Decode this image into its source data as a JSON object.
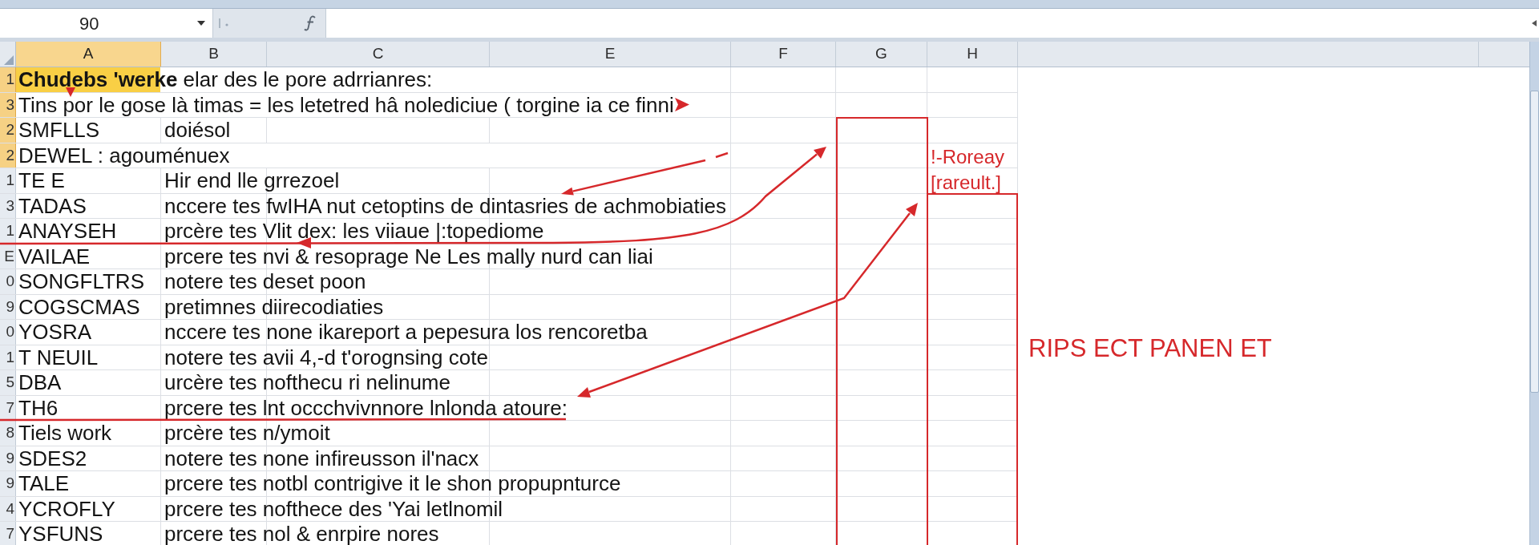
{
  "name_box": {
    "value": "90"
  },
  "columns": [
    {
      "label": "A",
      "selected": true
    },
    {
      "label": "B",
      "selected": false
    },
    {
      "label": "C",
      "selected": false
    },
    {
      "label": "E",
      "selected": false
    },
    {
      "label": "F",
      "selected": false
    },
    {
      "label": "G",
      "selected": false
    },
    {
      "label": "H",
      "selected": false
    }
  ],
  "rows": [
    {
      "header": "1",
      "selected": true,
      "highlighted": true,
      "A": "**Chudebs 'werke** elar des le pore adrrianres:"
    },
    {
      "header": "3",
      "selected": true,
      "highlighted": false,
      "A": "Tins por le gose là timas = les letetred hâ nolediciue ( torgine ia ce finni"
    },
    {
      "header": "2",
      "selected": true,
      "highlighted": false,
      "A": "SMFLLS",
      "B": "doiésol"
    },
    {
      "header": "2",
      "selected": true,
      "highlighted": false,
      "A": "DEWEL : agouménuex"
    },
    {
      "header": "1",
      "selected": false,
      "highlighted": false,
      "A": "TE E",
      "B": "Hir end lle grrezoel"
    },
    {
      "header": "3",
      "selected": false,
      "highlighted": false,
      "A": "TADAS",
      "B": "nccere tes fwIHA nut cetoptins de dintasries de achmobiaties"
    },
    {
      "header": "1",
      "selected": false,
      "highlighted": false,
      "A": "ANAYSEH",
      "B": "prcère tes Vlit dex: les viiaue |:topediome"
    },
    {
      "header": "E",
      "selected": false,
      "highlighted": false,
      "A": "VAILAE",
      "B": "prcere tes nvi & resoprage Ne Les mally nurd can liai"
    },
    {
      "header": "0",
      "selected": false,
      "highlighted": false,
      "A": "SONGFLTRS",
      "B": "notere tes deset poon"
    },
    {
      "header": "9",
      "selected": false,
      "highlighted": false,
      "A": "COGSCMAS",
      "B": "pretimnes diirecodiaties"
    },
    {
      "header": "0",
      "selected": false,
      "highlighted": false,
      "A": "YOSRA",
      "B": "nccere tes none ikareport a pepesura los rencoretba"
    },
    {
      "header": "1",
      "selected": false,
      "highlighted": false,
      "A": "T NEUIL",
      "B": "notere tes avii 4,-d t'orognsing cote"
    },
    {
      "header": "5",
      "selected": false,
      "highlighted": false,
      "A": "DBA",
      "B": "urcère tes nofthecu ri nelinume"
    },
    {
      "header": "7",
      "selected": false,
      "highlighted": false,
      "A": "TH6",
      "B": "prcere tes lnt occchvivnnore lnlonda atoure:"
    },
    {
      "header": "8",
      "selected": false,
      "highlighted": false,
      "A": "Tiels work",
      "B": "prcère tes n/ymoit"
    },
    {
      "header": "9",
      "selected": false,
      "highlighted": false,
      "A": "SDES2",
      "B": "notere tes none infireusson il'nacx"
    },
    {
      "header": "9",
      "selected": false,
      "highlighted": false,
      "A": "TALE",
      "B": "prcere tes notbl contrigive it le shon propupnturce"
    },
    {
      "header": "4",
      "selected": false,
      "highlighted": false,
      "A": "YCROFLY",
      "B": "prcere tes nofthece des 'Yai letlnomil"
    },
    {
      "header": "7",
      "selected": false,
      "highlighted": false,
      "A": "YSFUNS",
      "B": "prcere tes nol & enrpire nores"
    }
  ],
  "annotations": {
    "label_lines": [
      "!-Roreay",
      "[rareult.]"
    ],
    "note": "RIPS ECT PANEN ET"
  }
}
